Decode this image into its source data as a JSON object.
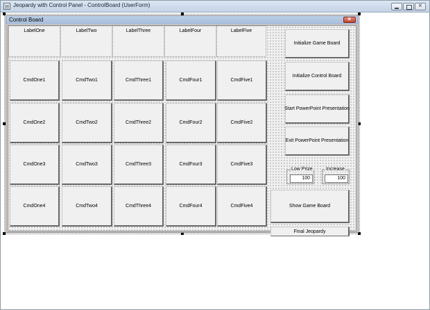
{
  "window": {
    "title": "Jeopardy with Control Panel - ControlBoard (UserForm)"
  },
  "userform": {
    "caption": "Control Board"
  },
  "labels": [
    "LabelOne",
    "LabelTwo",
    "LabelThree",
    "LabelFour",
    "LabelFive"
  ],
  "commands": [
    [
      "CmdOne1",
      "CmdTwo1",
      "CmdThree1",
      "CmdFour1",
      "CmdFive1"
    ],
    [
      "CmdOne2",
      "CmdTwo2",
      "CmdThree2",
      "CmdFour2",
      "CmdFive2"
    ],
    [
      "CmdOne3",
      "CmdTwo3",
      "CmdThree3",
      "CmdFour3",
      "CmdFive3"
    ],
    [
      "CmdOne4",
      "CmdTwo4",
      "CmdThree4",
      "CmdFour4",
      "CmdFive4"
    ]
  ],
  "side_buttons": {
    "init_game": "Initialize Game Board",
    "init_control": "Initialize Control Board",
    "start_ppt": "Start PowerPoint Presentation",
    "exit_ppt": "Exit PowerPoint Presentation",
    "show_board": "Show Game Board",
    "final": "Final Jeopardy"
  },
  "low_prize": {
    "caption": "Low Prize",
    "value": "100"
  },
  "increase": {
    "caption": "Increase",
    "value": "100"
  }
}
